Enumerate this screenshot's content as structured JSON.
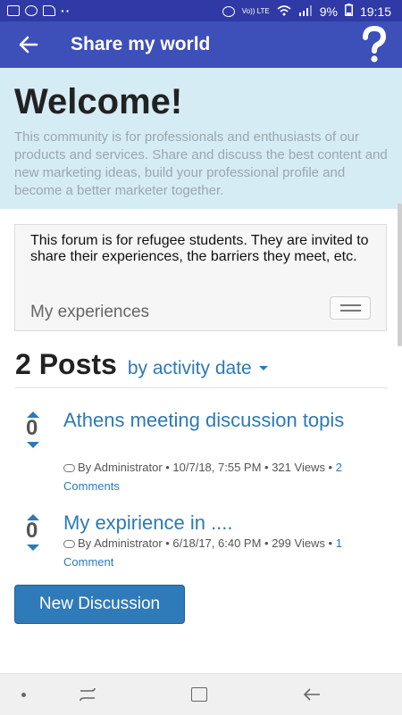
{
  "status_bar": {
    "battery": "9%",
    "time": "19:15",
    "carrier": "Vo)) LTE"
  },
  "app_bar": {
    "title": "Share my world"
  },
  "hero": {
    "heading": "Welcome!",
    "description": "This community is for professionals and enthusiasts of our products and services. Share and discuss the best content and new marketing ideas, build your professional profile and become a better marketer together."
  },
  "category": {
    "description": "This forum is for refugee students. They are invited to share their experiences, the barriers they meet, etc.",
    "name": "My experiences"
  },
  "posts_header": {
    "count_label": "2 Posts",
    "sort_label": "by activity date"
  },
  "posts": [
    {
      "title": "Athens meeting discussion topis",
      "votes": "0",
      "meta": "By Administrator • 10/7/18, 7:55 PM • 321 Views • ",
      "comments": "2 Comments"
    },
    {
      "title": "My expirience in ....",
      "votes": "0",
      "meta": "By Administrator • 6/18/17, 6:40 PM • 299 Views • ",
      "comments": "1 Comment"
    }
  ],
  "new_discussion_label": "New Discussion",
  "colors": {
    "app_bar": "#3d4fb8",
    "hero_bg": "#d6ecf5",
    "link": "#2d79b5",
    "button": "#2f7ab8"
  }
}
